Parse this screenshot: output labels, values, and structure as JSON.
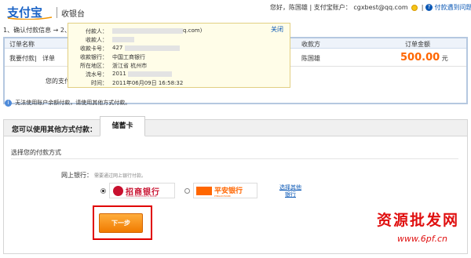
{
  "header": {
    "logo": "支付宝",
    "title": "收银台",
    "greeting": "您好，陈国雄",
    "account_label": "支付宝账户：",
    "account": "cgxbest@qq.com",
    "help_link": "付款遇到问题?"
  },
  "steps": {
    "text": "1、确认付款信息 → 2、付款 → 3、付款成功"
  },
  "order": {
    "headers": {
      "name": "订单名称",
      "payee": "收款方",
      "amount": "订单金额"
    },
    "row": {
      "name": "我要付款|",
      "detail": "详单",
      "payee": "陈国雄",
      "amount": "500.00",
      "currency": "元"
    },
    "partial_label": "您的支付"
  },
  "popup": {
    "close": "关闭",
    "rows": [
      {
        "label": "付款人：",
        "value": "q.com)"
      },
      {
        "label": "收款人：",
        "value": ""
      },
      {
        "label": "收款卡号：",
        "value": "427"
      },
      {
        "label": "收款银行：",
        "value": "中国工商银行"
      },
      {
        "label": "所在地区：",
        "value": "浙江省 杭州市"
      },
      {
        "label": "流水号：",
        "value": "2011"
      },
      {
        "label": "时间：",
        "value": "2011年06月09日 16:58:32"
      }
    ]
  },
  "notice": "无法使用账户余额付款，请使用其他方式付款。",
  "tabs": {
    "label": "您可以使用其他方式付款：",
    "active": "储蓄卡"
  },
  "payment": {
    "choose_title": "选择您的付款方式",
    "netbank_label": "网上银行：",
    "netbank_hint": "需要通过网上银行付款。",
    "banks": [
      {
        "name": "招商银行",
        "en": "CHINA MERCHANTS BANK",
        "selected": true
      },
      {
        "name": "平安银行",
        "en": "PINGAN BANK",
        "selected": false
      }
    ],
    "choose_other_line1": "选择其他",
    "choose_other_line2": "银行",
    "next_button": "下一步"
  },
  "watermark": {
    "cn": "资源批发网",
    "url": "www.6pf.cn"
  },
  "colors": {
    "accent_orange": "#ff6600",
    "link_blue": "#0b58b5",
    "highlight_red": "#e00000",
    "popup_bg": "#fffde8"
  }
}
